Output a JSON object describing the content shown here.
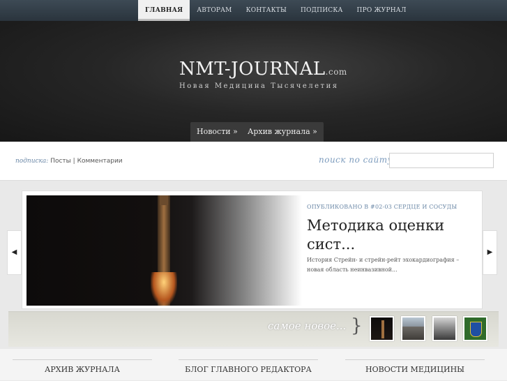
{
  "top_nav": {
    "items": [
      {
        "label": "ГЛАВНАЯ",
        "active": true
      },
      {
        "label": "АВТОРАМ",
        "active": false
      },
      {
        "label": "КОНТАКТЫ",
        "active": false
      },
      {
        "label": "ПОДПИСКА",
        "active": false
      },
      {
        "label": "ПРО ЖУРНАЛ",
        "active": false
      }
    ]
  },
  "header": {
    "logo_main": "NMT-JOURNAL",
    "logo_suffix": ".com",
    "tagline": "Новая Медицина Тысячелетия"
  },
  "sub_nav": {
    "items": [
      "Новости »",
      "Архив журнала »"
    ]
  },
  "subscribe": {
    "label": "подписка:",
    "posts": "Посты",
    "separator": "|",
    "comments": "Комментарии"
  },
  "search": {
    "label": "поиск по сайту",
    "placeholder": ""
  },
  "featured": {
    "meta": "ОПУБЛИКОВАНО В #02-03 СЕРДЦЕ И СОСУДЫ",
    "title": "Методика оценки сист...",
    "excerpt": "История Стрейн- и стрейн-рейт эхокардиография – новая область неинвазивной..."
  },
  "slider_arrows": {
    "prev": "◀",
    "next": "▶"
  },
  "newest": {
    "label": "самое новое...",
    "brace": "}",
    "thumbs": [
      "rocket-thumb",
      "road-thumb",
      "street-thumb",
      "emblem-thumb"
    ]
  },
  "bottom_columns": [
    "АРХИВ ЖУРНАЛА",
    "БЛОГ ГЛАВНОГО РЕДАКТОРА",
    "НОВОСТИ МЕДИЦИНЫ"
  ],
  "colors": {
    "topbar": "#2f3a44",
    "accent_link": "#6a87a6",
    "header_dark": "#1e1e1e"
  }
}
